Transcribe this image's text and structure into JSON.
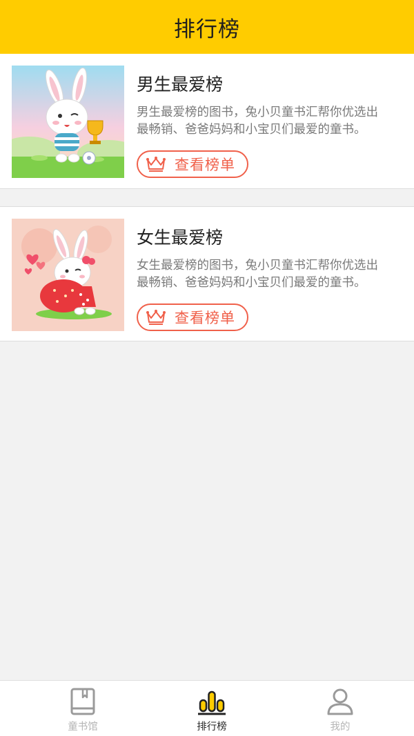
{
  "header": {
    "title": "排行榜"
  },
  "cards": [
    {
      "title": "男生最爱榜",
      "desc_line1": "男生最爱榜的图书，兔小贝童书汇帮你优选出",
      "desc_line2": "最畅销、爸爸妈妈和小宝贝们最爱的童书。",
      "button_label": "查看榜单",
      "image_icon": "rabbit-trophy-icon"
    },
    {
      "title": "女生最爱榜",
      "desc_line1": "女生最爱榜的图书，兔小贝童书汇帮你优选出",
      "desc_line2": "最畅销、爸爸妈妈和小宝贝们最爱的童书。",
      "button_label": "查看榜单",
      "image_icon": "rabbit-strawberry-icon"
    }
  ],
  "tabbar": {
    "items": [
      {
        "label": "童书馆",
        "icon": "book-icon",
        "active": false
      },
      {
        "label": "排行榜",
        "icon": "ranking-bars-icon",
        "active": true
      },
      {
        "label": "我的",
        "icon": "user-icon",
        "active": false
      }
    ]
  },
  "colors": {
    "header_bg": "#ffcc00",
    "accent": "#f0604a",
    "page_bg": "#f2f2f2",
    "tab_active": "#2a2a2a",
    "tab_inactive": "#b5b5b5"
  }
}
